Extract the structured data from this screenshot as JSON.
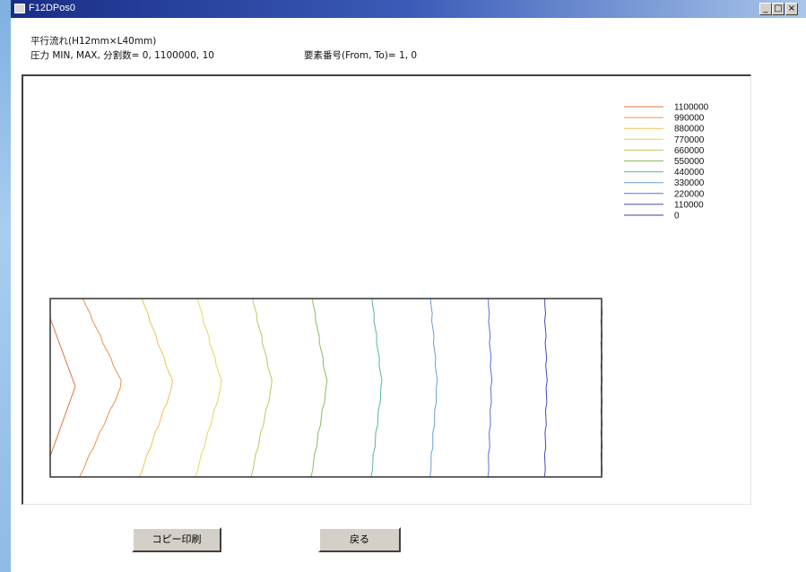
{
  "window": {
    "title": "F12DPos0",
    "minimize_label": "_",
    "maximize_label": "□",
    "close_label": "×"
  },
  "header": {
    "flow_title": "平行流れ(H12mm×L40mm)",
    "pressure_info": "圧力 MIN, MAX, 分割数= 0, 1100000, 10",
    "element_info": "要素番号(From, To)= 1, 0"
  },
  "chart_data": {
    "type": "contour",
    "title": "",
    "levels": [
      {
        "label": "1100000",
        "color": "#e0733c"
      },
      {
        "label": "990000",
        "color": "#eb934c"
      },
      {
        "label": "880000",
        "color": "#efc05a"
      },
      {
        "label": "770000",
        "color": "#e3d864"
      },
      {
        "label": "660000",
        "color": "#b5cd62"
      },
      {
        "label": "550000",
        "color": "#86bf5e"
      },
      {
        "label": "440000",
        "color": "#5bb59c"
      },
      {
        "label": "330000",
        "color": "#6a9fd4"
      },
      {
        "label": "220000",
        "color": "#5a72d2"
      },
      {
        "label": "110000",
        "color": "#4449bb"
      },
      {
        "label": "0",
        "color": "#3b3fa8"
      }
    ],
    "domain_mm": {
      "length": 40,
      "height": 12
    },
    "legend_placement": "top-right"
  },
  "buttons": {
    "copy_print": "コピー印刷",
    "back": "戻る"
  }
}
